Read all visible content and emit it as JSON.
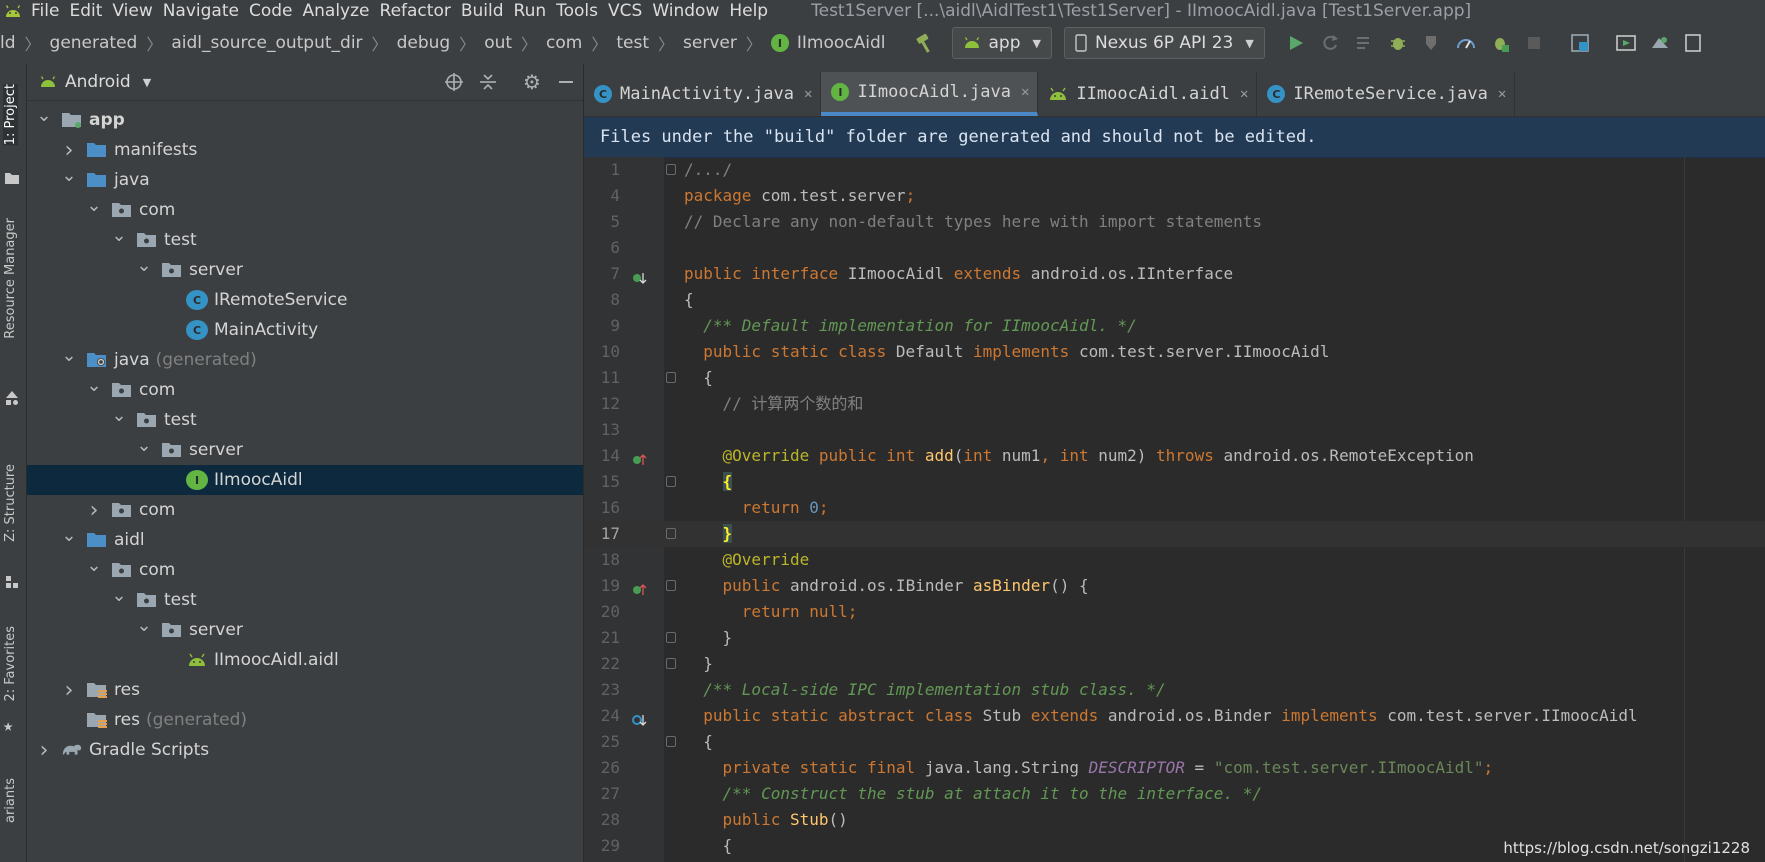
{
  "menubar": {
    "items": [
      "File",
      "Edit",
      "View",
      "Navigate",
      "Code",
      "Analyze",
      "Refactor",
      "Build",
      "Run",
      "Tools",
      "VCS",
      "Window",
      "Help"
    ],
    "title": "Test1Server [...\\aidl\\AidlTest1\\Test1Server] - IImoocAidl.java [Test1Server.app]"
  },
  "toolbar": {
    "breadcrumbs": [
      "ld",
      "generated",
      "aidl_source_output_dir",
      "debug",
      "out",
      "com",
      "test",
      "server",
      "IImoocAidl"
    ],
    "module": "app",
    "device": "Nexus 6P API 23"
  },
  "side_tabs": {
    "project": "1: Project",
    "resource_manager": "Resource Manager",
    "structure": "Z: Structure",
    "favorites": "2: Favorites",
    "variants": "ariants"
  },
  "project_panel": {
    "view": "Android",
    "tree": [
      {
        "label": "app",
        "suffix": "",
        "arrow": "down",
        "icon": "module-folder-icon",
        "bold": true
      },
      {
        "label": "manifests",
        "suffix": "",
        "arrow": "right",
        "icon": "folder-icon"
      },
      {
        "label": "java",
        "suffix": "",
        "arrow": "down",
        "icon": "folder-icon"
      },
      {
        "label": "com",
        "suffix": "",
        "arrow": "down",
        "icon": "package-icon"
      },
      {
        "label": "test",
        "suffix": "",
        "arrow": "down",
        "icon": "package-icon"
      },
      {
        "label": "server",
        "suffix": "",
        "arrow": "down",
        "icon": "package-icon"
      },
      {
        "label": "IRemoteService",
        "suffix": "",
        "arrow": "none",
        "icon": "class-icon"
      },
      {
        "label": "MainActivity",
        "suffix": "",
        "arrow": "none",
        "icon": "class-icon"
      },
      {
        "label": "java",
        "suffix": "(generated)",
        "arrow": "down",
        "icon": "generated-folder-icon"
      },
      {
        "label": "com",
        "suffix": "",
        "arrow": "down",
        "icon": "package-icon"
      },
      {
        "label": "test",
        "suffix": "",
        "arrow": "down",
        "icon": "package-icon"
      },
      {
        "label": "server",
        "suffix": "",
        "arrow": "down",
        "icon": "package-icon"
      },
      {
        "label": "IImoocAidl",
        "suffix": "",
        "arrow": "none",
        "icon": "interface-icon",
        "selected": true
      },
      {
        "label": "com",
        "suffix": "",
        "arrow": "right",
        "icon": "package-icon"
      },
      {
        "label": "aidl",
        "suffix": "",
        "arrow": "down",
        "icon": "folder-icon"
      },
      {
        "label": "com",
        "suffix": "",
        "arrow": "down",
        "icon": "package-icon"
      },
      {
        "label": "test",
        "suffix": "",
        "arrow": "down",
        "icon": "package-icon"
      },
      {
        "label": "server",
        "suffix": "",
        "arrow": "down",
        "icon": "package-icon"
      },
      {
        "label": "IImoocAidl.aidl",
        "suffix": "",
        "arrow": "none",
        "icon": "android-icon"
      },
      {
        "label": "res",
        "suffix": "",
        "arrow": "right",
        "icon": "res-folder-icon"
      },
      {
        "label": "res",
        "suffix": "(generated)",
        "arrow": "none",
        "icon": "res-folder-icon"
      },
      {
        "label": "Gradle Scripts",
        "suffix": "",
        "arrow": "right",
        "icon": "gradle-icon"
      }
    ]
  },
  "editor": {
    "tabs": [
      {
        "label": "MainActivity.java",
        "icon": "class-icon",
        "active": false
      },
      {
        "label": "IImoocAidl.java",
        "icon": "interface-icon",
        "active": true
      },
      {
        "label": "IImoocAidl.aidl",
        "icon": "android-icon",
        "active": false
      },
      {
        "label": "IRemoteService.java",
        "icon": "class-icon",
        "active": false
      }
    ],
    "banner": "Files under the \"build\" folder are generated and should not be edited.",
    "current_line": 17,
    "lines": [
      {
        "n": "1",
        "mark": "",
        "fold": true,
        "tokens": [
          {
            "t": "/.../",
            "c": "cm"
          }
        ]
      },
      {
        "n": "4",
        "mark": "",
        "fold": false,
        "tokens": [
          {
            "t": "package ",
            "c": "kw"
          },
          {
            "t": "com.test.server",
            "c": ""
          },
          {
            "t": ";",
            "c": "kw"
          }
        ]
      },
      {
        "n": "5",
        "mark": "",
        "fold": false,
        "tokens": [
          {
            "t": "// Declare any non-default types here with import statements",
            "c": "cm"
          }
        ]
      },
      {
        "n": "6",
        "mark": "",
        "fold": false,
        "tokens": []
      },
      {
        "n": "7",
        "mark": "implemented",
        "fold": false,
        "tokens": [
          {
            "t": "public interface ",
            "c": "kw"
          },
          {
            "t": "IImoocAidl ",
            "c": ""
          },
          {
            "t": "extends ",
            "c": "kw"
          },
          {
            "t": "android.os.IInterface",
            "c": ""
          }
        ]
      },
      {
        "n": "8",
        "mark": "",
        "fold": false,
        "tokens": [
          {
            "t": "{",
            "c": ""
          }
        ]
      },
      {
        "n": "9",
        "mark": "",
        "fold": false,
        "tokens": [
          {
            "t": "  /** Default implementation for IImoocAidl. */",
            "c": "doc"
          }
        ]
      },
      {
        "n": "10",
        "mark": "",
        "fold": false,
        "tokens": [
          {
            "t": "  public static class ",
            "c": "kw"
          },
          {
            "t": "Default ",
            "c": ""
          },
          {
            "t": "implements ",
            "c": "kw"
          },
          {
            "t": "com.test.server.IImoocAidl",
            "c": ""
          }
        ]
      },
      {
        "n": "11",
        "mark": "",
        "fold": true,
        "tokens": [
          {
            "t": "  {",
            "c": ""
          }
        ]
      },
      {
        "n": "12",
        "mark": "",
        "fold": false,
        "tokens": [
          {
            "t": "    // 计算两个数的和",
            "c": "cm"
          }
        ]
      },
      {
        "n": "13",
        "mark": "",
        "fold": false,
        "tokens": []
      },
      {
        "n": "14",
        "mark": "overrides",
        "fold": false,
        "tokens": [
          {
            "t": "    @Override ",
            "c": "an"
          },
          {
            "t": "public int ",
            "c": "kw"
          },
          {
            "t": "add",
            "c": "fn"
          },
          {
            "t": "(",
            "c": ""
          },
          {
            "t": "int ",
            "c": "kw"
          },
          {
            "t": "num1",
            "c": ""
          },
          {
            "t": ", ",
            "c": "kw"
          },
          {
            "t": "int ",
            "c": "kw"
          },
          {
            "t": "num2) ",
            "c": ""
          },
          {
            "t": "throws ",
            "c": "kw"
          },
          {
            "t": "android.os.RemoteException",
            "c": ""
          }
        ]
      },
      {
        "n": "15",
        "mark": "",
        "fold": true,
        "tokens": [
          {
            "t": "    ",
            "c": ""
          },
          {
            "t": "{",
            "c": "brace-hl"
          }
        ]
      },
      {
        "n": "16",
        "mark": "",
        "fold": false,
        "tokens": [
          {
            "t": "      return ",
            "c": "kw"
          },
          {
            "t": "0",
            "c": "num"
          },
          {
            "t": ";",
            "c": "kw"
          }
        ]
      },
      {
        "n": "17",
        "mark": "",
        "fold": true,
        "tokens": [
          {
            "t": "    ",
            "c": ""
          },
          {
            "t": "}",
            "c": "brace-hl"
          }
        ]
      },
      {
        "n": "18",
        "mark": "",
        "fold": false,
        "tokens": [
          {
            "t": "    @Override",
            "c": "an"
          }
        ]
      },
      {
        "n": "19",
        "mark": "overrides",
        "fold": true,
        "tokens": [
          {
            "t": "    public ",
            "c": "kw"
          },
          {
            "t": "android.os.IBinder ",
            "c": ""
          },
          {
            "t": "asBinder",
            "c": "fn"
          },
          {
            "t": "() {",
            "c": ""
          }
        ]
      },
      {
        "n": "20",
        "mark": "",
        "fold": false,
        "tokens": [
          {
            "t": "      return null;",
            "c": "kw"
          }
        ]
      },
      {
        "n": "21",
        "mark": "",
        "fold": true,
        "tokens": [
          {
            "t": "    }",
            "c": ""
          }
        ]
      },
      {
        "n": "22",
        "mark": "",
        "fold": true,
        "tokens": [
          {
            "t": "  }",
            "c": ""
          }
        ]
      },
      {
        "n": "23",
        "mark": "",
        "fold": false,
        "tokens": [
          {
            "t": "  /** Local-side IPC implementation stub class. */",
            "c": "doc"
          }
        ]
      },
      {
        "n": "24",
        "mark": "subclassed",
        "fold": false,
        "tokens": [
          {
            "t": "  public static abstract class ",
            "c": "kw"
          },
          {
            "t": "Stub ",
            "c": ""
          },
          {
            "t": "extends ",
            "c": "kw"
          },
          {
            "t": "android.os.Binder ",
            "c": ""
          },
          {
            "t": "implements ",
            "c": "kw"
          },
          {
            "t": "com.test.server.IImoocAidl",
            "c": ""
          }
        ]
      },
      {
        "n": "25",
        "mark": "",
        "fold": true,
        "tokens": [
          {
            "t": "  {",
            "c": ""
          }
        ]
      },
      {
        "n": "26",
        "mark": "",
        "fold": false,
        "tokens": [
          {
            "t": "    private static final ",
            "c": "kw"
          },
          {
            "t": "java.lang.String ",
            "c": ""
          },
          {
            "t": "DESCRIPTOR",
            "c": "const"
          },
          {
            "t": " = ",
            "c": ""
          },
          {
            "t": "\"com.test.server.IImoocAidl\"",
            "c": "str"
          },
          {
            "t": ";",
            "c": "kw"
          }
        ]
      },
      {
        "n": "27",
        "mark": "",
        "fold": false,
        "tokens": [
          {
            "t": "    /** Construct the stub at attach it to the interface. */",
            "c": "doc"
          }
        ]
      },
      {
        "n": "28",
        "mark": "",
        "fold": false,
        "tokens": [
          {
            "t": "    public ",
            "c": "kw"
          },
          {
            "t": "Stub",
            "c": "fn"
          },
          {
            "t": "()",
            "c": ""
          }
        ]
      },
      {
        "n": "29",
        "mark": "",
        "fold": false,
        "tokens": [
          {
            "t": "    {",
            "c": ""
          }
        ]
      }
    ]
  },
  "watermark": "https://blog.csdn.net/songzi1228"
}
